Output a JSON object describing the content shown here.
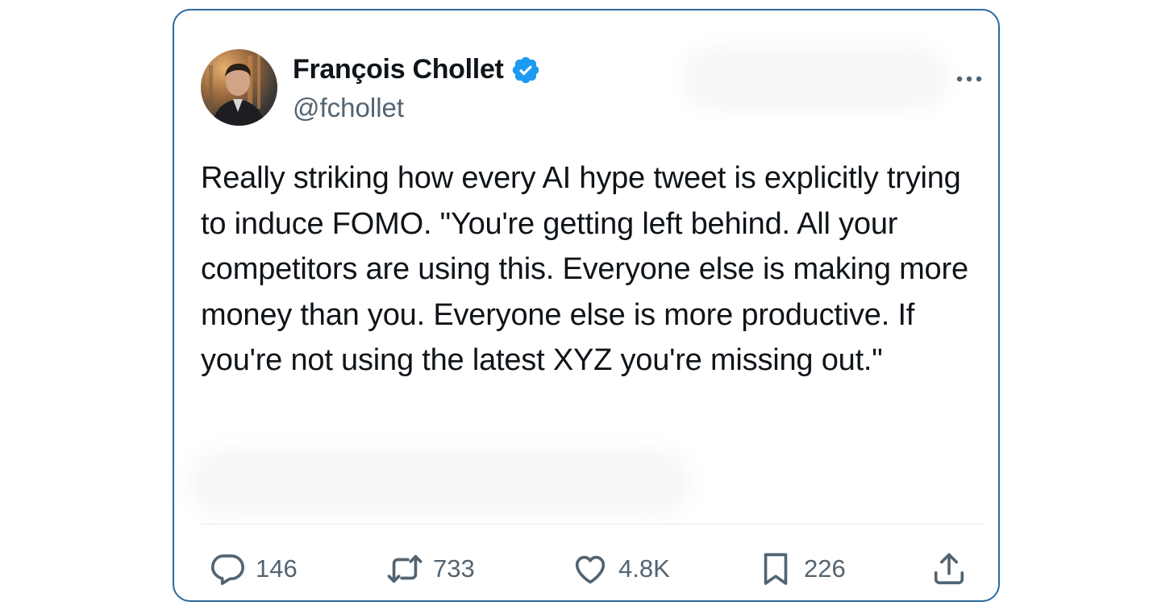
{
  "author": {
    "display_name": "François Chollet",
    "handle": "@fchollet",
    "verified": true,
    "verified_color": "#1d9bf0"
  },
  "tweet": {
    "text": "Really striking how every AI hype tweet is explicitly trying to induce FOMO. \"You're getting left behind. All your competitors are using this. Everyone else is making more money than you. Everyone else is more productive. If you're not using the latest XYZ you're missing out.\""
  },
  "actions": {
    "replies": "146",
    "reposts": "733",
    "likes": "4.8K",
    "bookmarks": "226"
  },
  "icons": {
    "more": "more-horizontal-icon",
    "reply": "reply-icon",
    "repost": "repost-icon",
    "like": "heart-icon",
    "bookmark": "bookmark-icon",
    "share": "share-icon"
  },
  "colors": {
    "card_border": "#2a6a9e",
    "secondary_text": "#536471",
    "primary_text": "#0f1419"
  }
}
